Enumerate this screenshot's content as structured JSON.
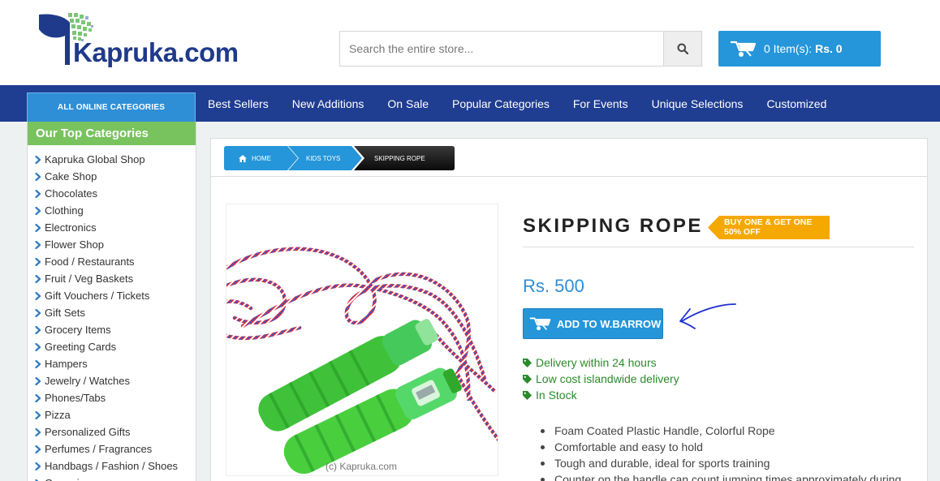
{
  "header": {
    "logo_text": "Kapruka.com",
    "search_placeholder": "Search the entire store...",
    "cart_count_text": "0 Item(s):",
    "cart_amount": "Rs. 0"
  },
  "nav": {
    "all_categories": "ALL ONLINE CATEGORIES",
    "items": [
      "Best Sellers",
      "New Additions",
      "On Sale",
      "Popular Categories",
      "For Events",
      "Unique Selections",
      "Customized"
    ]
  },
  "sidebar": {
    "title": "Our Top Categories",
    "items": [
      "Kapruka Global Shop",
      "Cake Shop",
      "Chocolates",
      "Clothing",
      "Electronics",
      "Flower Shop",
      "Food / Restaurants",
      "Fruit / Veg Baskets",
      "Gift Vouchers / Tickets",
      "Gift Sets",
      "Grocery Items",
      "Greeting Cards",
      "Hampers",
      "Jewelry / Watches",
      "Phones/Tabs",
      "Pizza",
      "Personalized Gifts",
      "Perfumes / Fragrances",
      "Handbags / Fashion / Shoes",
      "Groceries"
    ]
  },
  "breadcrumb": {
    "home": "HOME",
    "category": "KIDS TOYS",
    "current": "SKIPPING ROPE"
  },
  "product": {
    "title": "SKIPPING ROPE",
    "offer_line1": "BUY ONE & GET ONE",
    "offer_line2": "50% OFF",
    "price": "Rs. 500",
    "add_button": "ADD TO W.BARROW",
    "watermark": "(c) Kapruka.com",
    "info": [
      "Delivery within 24 hours",
      "Low cost islandwide delivery",
      "In Stock"
    ],
    "features": [
      "Foam Coated Plastic Handle, Colorful Rope",
      "Comfortable and easy to hold",
      "Tough and durable, ideal for sports training",
      "Counter on the handle can count jumping times approximately during"
    ]
  },
  "colors": {
    "nav_bg": "#1f3d91",
    "accent_blue": "#2596d9",
    "sidebar_header": "#79c35f",
    "offer_badge": "#f5a800",
    "info_green": "#2b8a2b",
    "price_blue": "#2e8ed4"
  }
}
